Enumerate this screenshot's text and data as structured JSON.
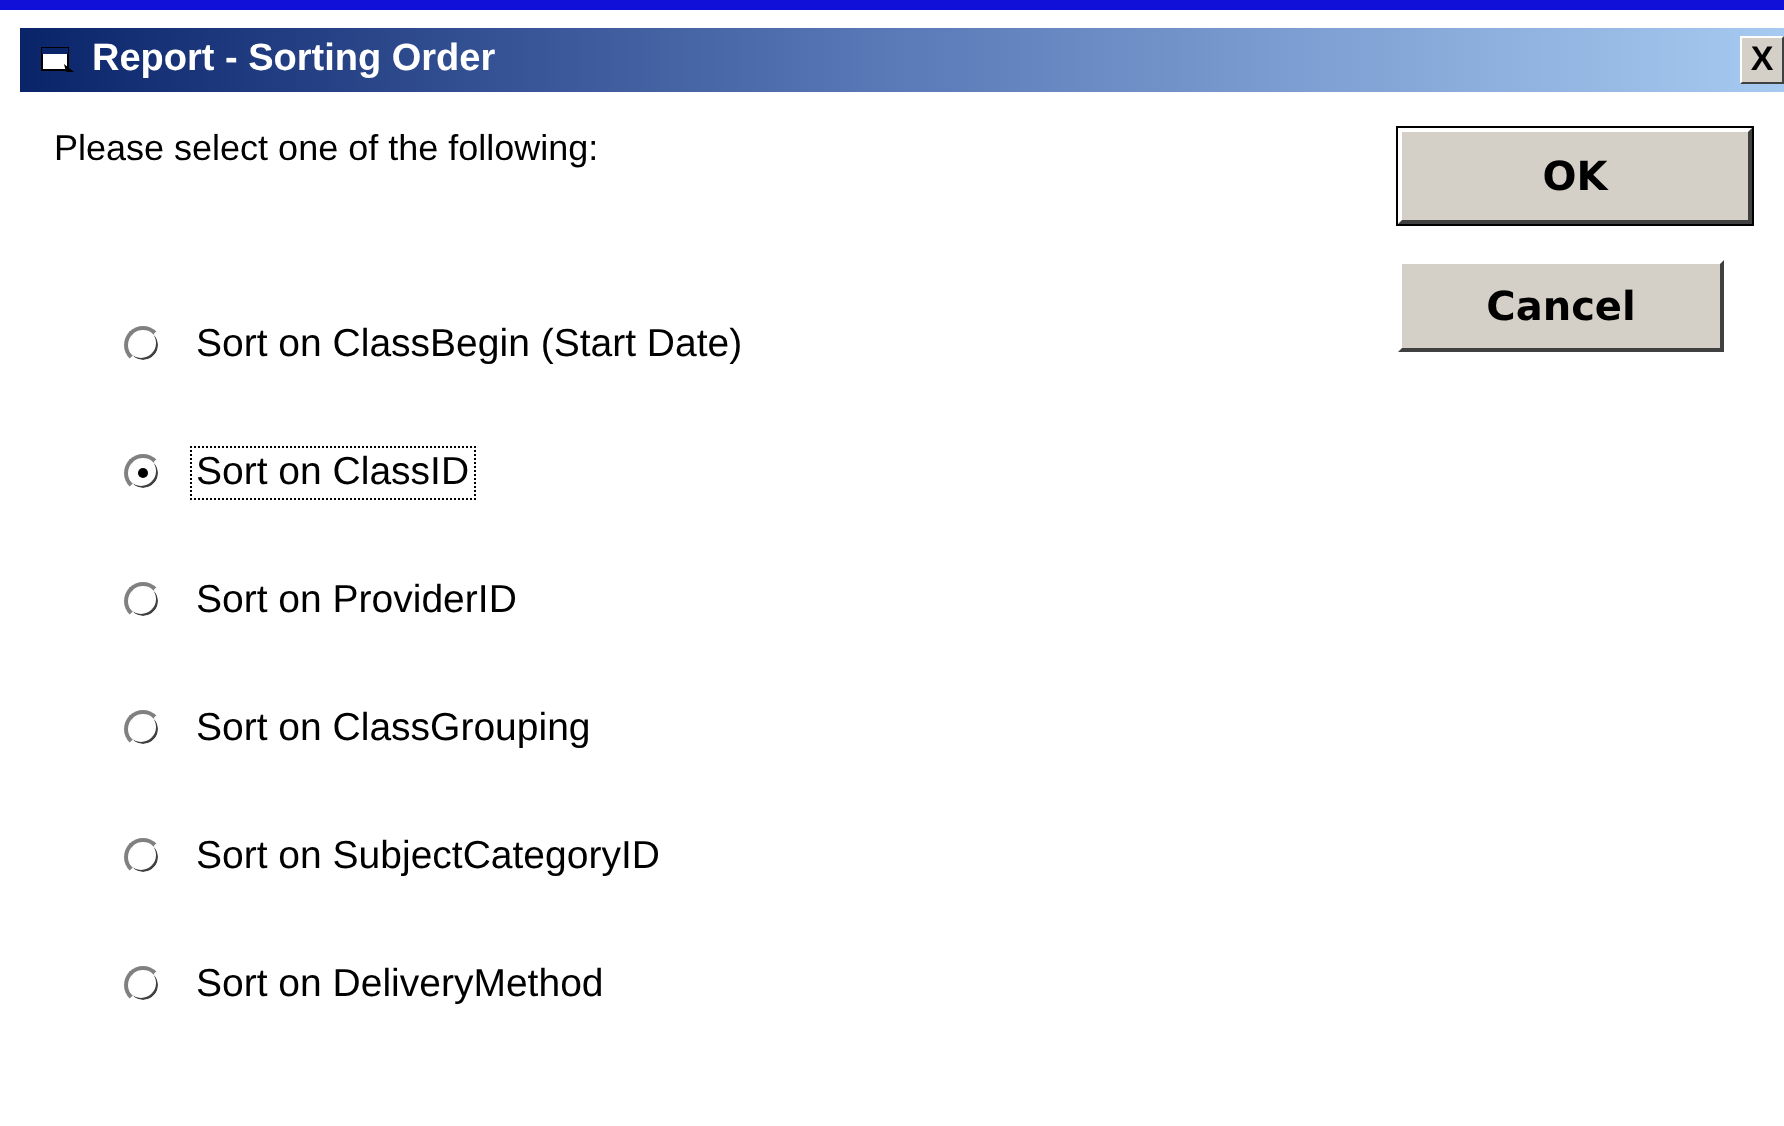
{
  "window": {
    "title": "Report - Sorting Order",
    "close": "X"
  },
  "prompt": "Please select one of the following:",
  "options": [
    {
      "label": "Sort on ClassBegin (Start Date)",
      "selected": false
    },
    {
      "label": "Sort on ClassID",
      "selected": true
    },
    {
      "label": "Sort on ProviderID",
      "selected": false
    },
    {
      "label": "Sort on ClassGrouping",
      "selected": false
    },
    {
      "label": "Sort on SubjectCategoryID",
      "selected": false
    },
    {
      "label": "Sort on DeliveryMethod",
      "selected": false
    }
  ],
  "buttons": [
    {
      "label": "OK",
      "default": true
    },
    {
      "label": "Cancel",
      "default": false
    }
  ]
}
